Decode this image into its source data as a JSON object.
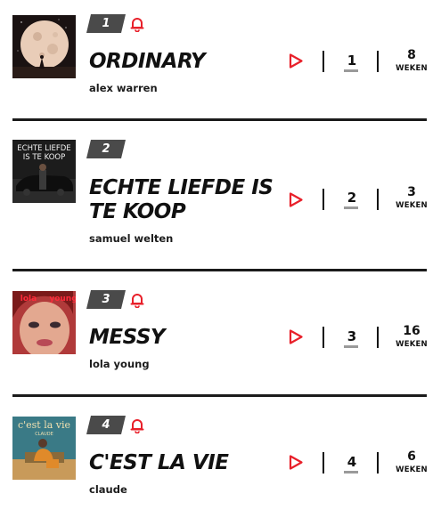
{
  "accent_color": "#e8202a",
  "badge_color": "#4a4a4a",
  "entries": [
    {
      "rank": "1",
      "title": "ORDINARY",
      "artist": "alex warren",
      "previous_rank": "1",
      "weeks": "8",
      "weeks_label": "WEKEN",
      "bell": true,
      "icons": {
        "bell": "bell-icon",
        "play": "play-icon"
      }
    },
    {
      "rank": "2",
      "title": "ECHTE LIEFDE IS TE KOOP",
      "artist": "samuel welten",
      "previous_rank": "2",
      "weeks": "3",
      "weeks_label": "WEKEN",
      "cover_text": "ECHTE LIEFDE IS TE KOOP",
      "bell": false,
      "icons": {
        "play": "play-icon"
      }
    },
    {
      "rank": "3",
      "title": "MESSY",
      "artist": "lola young",
      "previous_rank": "3",
      "weeks": "16",
      "weeks_label": "WEKEN",
      "cover_text": "young",
      "bell": true,
      "icons": {
        "bell": "bell-icon",
        "play": "play-icon"
      }
    },
    {
      "rank": "4",
      "title": "C'EST LA VIE",
      "artist": "claude",
      "previous_rank": "4",
      "weeks": "6",
      "weeks_label": "WEKEN",
      "cover_text": "c'est la vie",
      "cover_subtext": "CLAUDE",
      "bell": true,
      "icons": {
        "bell": "bell-icon",
        "play": "play-icon"
      }
    }
  ]
}
